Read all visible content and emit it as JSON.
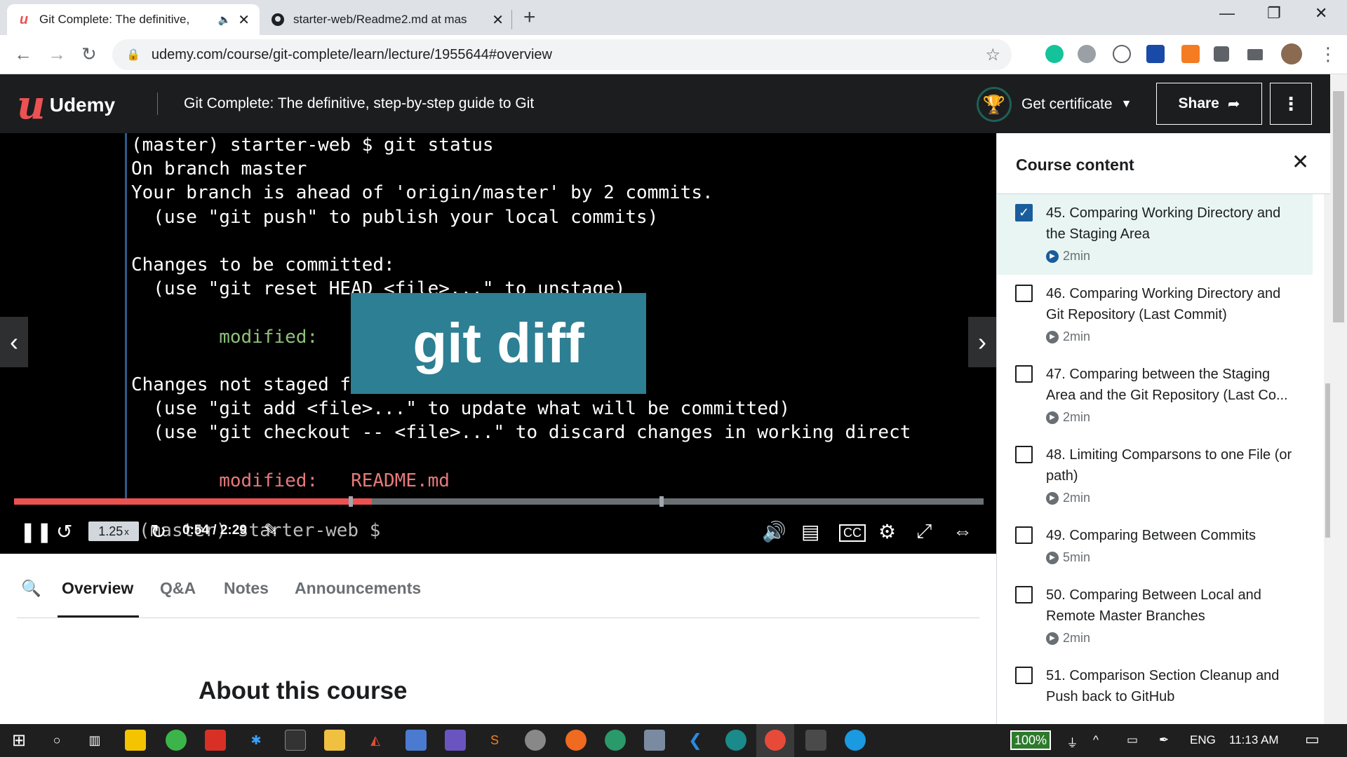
{
  "browser": {
    "tabs": [
      {
        "title": "Git Complete: The definitive,",
        "active": true
      },
      {
        "title": "starter-web/Readme2.md at mas",
        "active": false
      }
    ],
    "url": "udemy.com/course/git-complete/learn/lecture/1955644#overview"
  },
  "header": {
    "logo": "Udemy",
    "course_title": "Git Complete: The definitive, step-by-step guide to Git",
    "certificate": "Get certificate",
    "share": "Share"
  },
  "video": {
    "terminal_lines": [
      "(master) starter-web $ git status",
      "On branch master",
      "Your branch is ahead of 'origin/master' by 2 commits.",
      "  (use \"git push\" to publish your local commits)",
      "",
      "Changes to be committed:",
      "  (use \"git reset HEAD <file>...\" to unstage)",
      "",
      "        modified:   R",
      "",
      "Changes not staged fo",
      "  (use \"git add <file>...\" to update what will be committed)",
      "  (use \"git checkout -- <file>...\" to discard changes in working direct",
      "",
      "        modified:   README.md"
    ],
    "overlay_text": "git diff",
    "speed": "1.25",
    "speed_suffix": "x",
    "time": "0:54 / 2:29",
    "ghost_prompt": "(master) starter-web $",
    "progress_fraction": 0.369
  },
  "lower_tabs": [
    "Overview",
    "Q&A",
    "Notes",
    "Announcements"
  ],
  "about_heading": "About this course",
  "sidebar": {
    "title": "Course content",
    "items": [
      {
        "title": "45. Comparing Working Directory and the Staging Area",
        "duration": "2min",
        "checked": true,
        "current": true
      },
      {
        "title": "46. Comparing Working Directory and Git Repository (Last Commit)",
        "duration": "2min",
        "checked": false,
        "current": false
      },
      {
        "title": "47. Comparing between the Staging Area and the Git Repository (Last Co...",
        "duration": "2min",
        "checked": false,
        "current": false
      },
      {
        "title": "48. Limiting Comparsons to one File (or path)",
        "duration": "2min",
        "checked": false,
        "current": false
      },
      {
        "title": "49. Comparing Between Commits",
        "duration": "5min",
        "checked": false,
        "current": false
      },
      {
        "title": "50. Comparing Between Local and Remote Master Branches",
        "duration": "2min",
        "checked": false,
        "current": false
      },
      {
        "title": "51. Comparison Section Cleanup and Push back to GitHub",
        "duration": "",
        "checked": false,
        "current": false
      }
    ]
  },
  "taskbar": {
    "battery": "100%",
    "lang": "ENG",
    "clock": "11:13 AM"
  }
}
